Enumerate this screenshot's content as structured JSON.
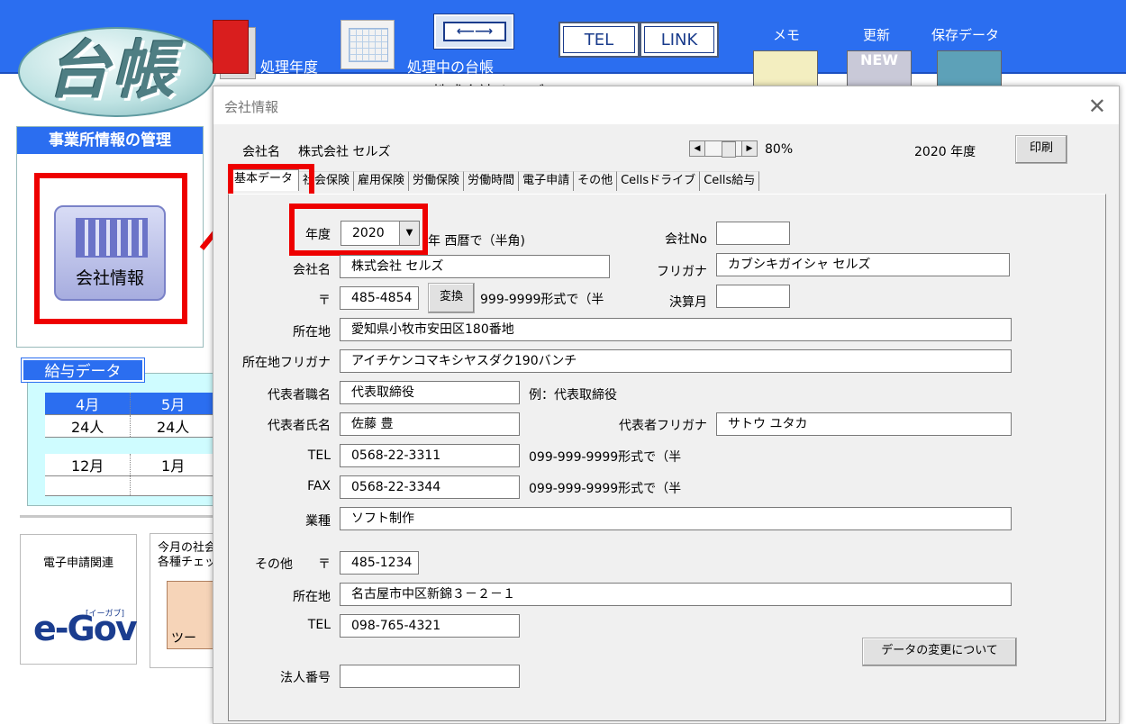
{
  "app": {
    "logo_text": "台帳",
    "labels": {
      "year": "処理年度",
      "ledger": "処理中の台帳"
    },
    "buttons": {
      "tel": "TEL",
      "link": "LINK",
      "memo": "メモ",
      "update": "更新",
      "saved": "保存データ"
    },
    "icon_overlay": "NEW",
    "company_under": "株式会社 セルズ",
    "left_panel": {
      "title": "事業所情報の管理",
      "company_button": "会社情報"
    },
    "salary": {
      "title": "給与データ",
      "row1_months": [
        "4月",
        "5月"
      ],
      "row1_counts": [
        "24人",
        "24人"
      ],
      "row2_months": [
        "12月",
        "1月"
      ]
    },
    "egov": {
      "title": "電子申請関連",
      "logo": "e-Gov",
      "sub": "[イーガブ]"
    },
    "check": {
      "title_line1": "今月の社会",
      "title_line2": "各種チェッ",
      "icon_label": "ツー"
    }
  },
  "dialog": {
    "title": "会社情報",
    "close_icon": "✕",
    "company_name_label": "会社名",
    "company_name_value": "株式会社 セルズ",
    "zoom": "80%",
    "year_display": "2020 年度",
    "print_button": "印刷",
    "tabs": [
      "基本データ",
      "社会保険",
      "雇用保険",
      "労働保険",
      "労働時間",
      "電子申請",
      "その他",
      "Cellsドライブ",
      "Cells給与"
    ],
    "form": {
      "year_label": "年度",
      "year_value": "2020",
      "year_note": "年  西暦で（半角)",
      "company_no_label": "会社No",
      "company_no_value": "",
      "name_label": "会社名",
      "name_value": "株式会社 セルズ",
      "furigana_label": "フリガナ",
      "furigana_value": "カブシキガイシャ セルズ",
      "zip_label": "〒",
      "zip_value": "485-4854",
      "convert_button": "変換",
      "zip_note": "999-9999形式で（半",
      "fiscal_month_label": "決算月",
      "fiscal_month_value": "",
      "address_label": "所在地",
      "address_value": "愛知県小牧市安田区180番地",
      "address_kana_label": "所在地フリガナ",
      "address_kana_value": "アイチケンコマキシヤスダク190バンチ",
      "rep_title_label": "代表者職名",
      "rep_title_value": "代表取締役",
      "rep_title_note": "例：代表取締役",
      "rep_name_label": "代表者氏名",
      "rep_name_value": "佐藤  豊",
      "rep_kana_label": "代表者フリガナ",
      "rep_kana_value": "サトウ ユタカ",
      "tel_label": "TEL",
      "tel_value": "0568-22-3311",
      "tel_note": "099-999-9999形式で（半",
      "fax_label": "FAX",
      "fax_value": "0568-22-3344",
      "fax_note": "099-999-9999形式で（半",
      "industry_label": "業種",
      "industry_value": "ソフト制作",
      "other_label": "その他",
      "other_zip_label": "〒",
      "other_zip_value": "485-1234",
      "other_address_label": "所在地",
      "other_address_value": "名古屋市中区新錦３－２－１",
      "other_tel_label": "TEL",
      "other_tel_value": "098-765-4321",
      "change_button": "データの変更について",
      "corp_no_label": "法人番号",
      "corp_no_value": ""
    }
  }
}
